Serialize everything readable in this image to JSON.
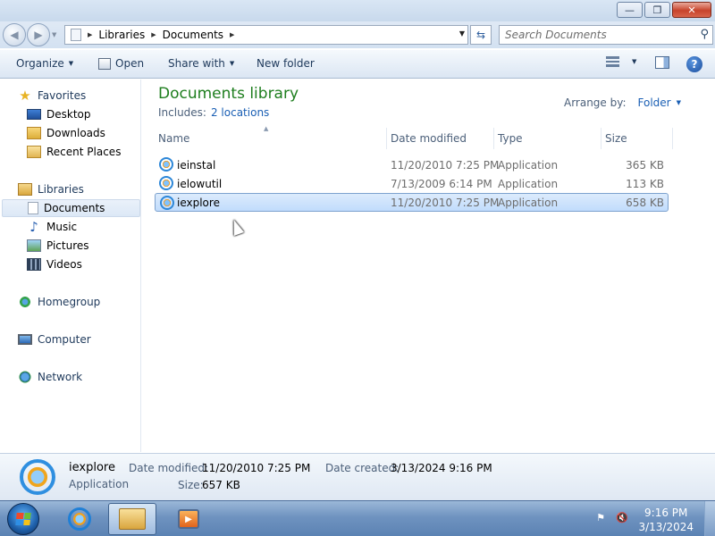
{
  "window": {
    "controls": {
      "minimize": "—",
      "maximize": "❐",
      "close": "✕"
    }
  },
  "nav": {
    "back_icon": "back-arrow",
    "forward_icon": "forward-arrow",
    "breadcrumb": [
      "Libraries",
      "Documents"
    ],
    "search_placeholder": "Search Documents"
  },
  "toolbar": {
    "organize": "Organize",
    "open": "Open",
    "share_with": "Share with",
    "new_folder": "New folder"
  },
  "sidebar": {
    "favorites": {
      "label": "Favorites",
      "items": [
        "Desktop",
        "Downloads",
        "Recent Places"
      ]
    },
    "libraries": {
      "label": "Libraries",
      "items": [
        "Documents",
        "Music",
        "Pictures",
        "Videos"
      ],
      "selected": "Documents"
    },
    "homegroup": "Homegroup",
    "computer": "Computer",
    "network": "Network"
  },
  "main": {
    "title": "Documents library",
    "includes_label": "Includes:",
    "includes_link": "2 locations",
    "arrange_label": "Arrange by:",
    "arrange_value": "Folder",
    "columns": [
      "Name",
      "Date modified",
      "Type",
      "Size"
    ],
    "files": [
      {
        "name": "ieinstal",
        "modified": "11/20/2010 7:25 PM",
        "type": "Application",
        "size": "365 KB"
      },
      {
        "name": "ielowutil",
        "modified": "7/13/2009 6:14 PM",
        "type": "Application",
        "size": "113 KB"
      },
      {
        "name": "iexplore",
        "modified": "11/20/2010 7:25 PM",
        "type": "Application",
        "size": "658 KB"
      }
    ],
    "selected_file": "iexplore"
  },
  "details": {
    "name": "iexplore",
    "type": "Application",
    "date_modified_label": "Date modified:",
    "date_modified": "11/20/2010 7:25 PM",
    "size_label": "Size:",
    "size": "657 KB",
    "date_created_label": "Date created:",
    "date_created": "3/13/2024 9:16 PM"
  },
  "taskbar": {
    "time": "9:16 PM",
    "date": "3/13/2024"
  },
  "colors": {
    "library_title": "#1e7e1e",
    "link": "#1a5fb4",
    "selection": "#c1dcfc"
  }
}
